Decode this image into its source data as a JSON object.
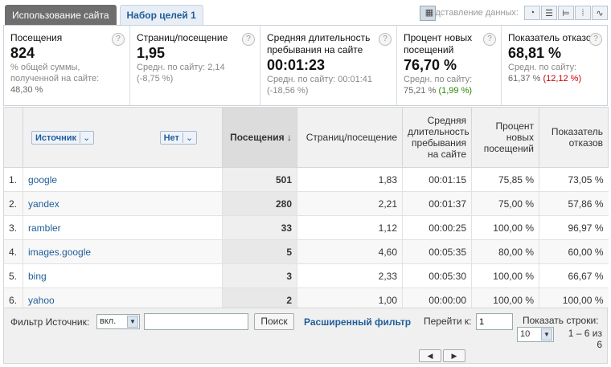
{
  "tabs": [
    "Использование сайта",
    "Набор целей 1"
  ],
  "views_label": "Представление данных:",
  "summary": [
    {
      "title": "Посещения",
      "value": "824",
      "sub1": "% общей суммы, полученной на сайте:",
      "sub2": "48,30 %"
    },
    {
      "title": "Страниц/посещение",
      "value": "1,95",
      "sub1": "Средн. по сайту: 2,14",
      "sub2": "(-8,75 %)"
    },
    {
      "title": "Средняя длительность пребывания на сайте",
      "value": "00:01:23",
      "sub1": "Средн. по сайту: 00:01:41",
      "sub2": "(-18,56 %)"
    },
    {
      "title": "Процент новых посещений",
      "value": "76,70 %",
      "sub1": "Средн. по сайту:",
      "sub2a": "75,21 %",
      "sub2b": "(1,99 %)"
    },
    {
      "title": "Показатель отказов",
      "value": "68,81 %",
      "sub1": "Средн. по сайту:",
      "sub2a": "61,37 %",
      "sub2b": "(12,12 %)"
    }
  ],
  "headers": {
    "source": "Источник",
    "none": "Нет",
    "visits": "Посещения",
    "pages": "Страниц/посещение",
    "duration": "Средняя длительность пребывания на сайте",
    "new": "Процент новых посещений",
    "bounce": "Показатель отказов"
  },
  "rows": [
    {
      "n": "1.",
      "src": "google",
      "v": "501",
      "p": "1,83",
      "d": "00:01:15",
      "nw": "75,85 %",
      "b": "73,05 %"
    },
    {
      "n": "2.",
      "src": "yandex",
      "v": "280",
      "p": "2,21",
      "d": "00:01:37",
      "nw": "75,00 %",
      "b": "57,86 %"
    },
    {
      "n": "3.",
      "src": "rambler",
      "v": "33",
      "p": "1,12",
      "d": "00:00:25",
      "nw": "100,00 %",
      "b": "96,97 %"
    },
    {
      "n": "4.",
      "src": "images.google",
      "v": "5",
      "p": "4,60",
      "d": "00:05:35",
      "nw": "80,00 %",
      "b": "60,00 %"
    },
    {
      "n": "5.",
      "src": "bing",
      "v": "3",
      "p": "2,33",
      "d": "00:05:30",
      "nw": "100,00 %",
      "b": "66,67 %"
    },
    {
      "n": "6.",
      "src": "yahoo",
      "v": "2",
      "p": "1,00",
      "d": "00:00:00",
      "nw": "100,00 %",
      "b": "100,00 %"
    }
  ],
  "footer": {
    "filter_label": "Фильтр Источник:",
    "filter_mode": "вкл.",
    "filter_value": "",
    "search": "Поиск",
    "advanced": "Расширенный фильтр",
    "goto_label": "Перейти к:",
    "goto_value": "1",
    "rows_label": "Показать строки:",
    "rows_value": "10",
    "range": "1 – 6 из 6"
  }
}
